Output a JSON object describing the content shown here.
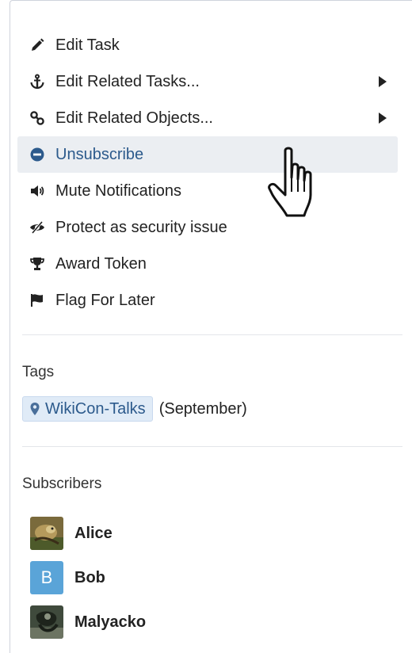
{
  "actions": [
    {
      "label": "Edit Task",
      "icon": "pencil-icon",
      "submenu": false
    },
    {
      "label": "Edit Related Tasks...",
      "icon": "anchor-icon",
      "submenu": true
    },
    {
      "label": "Edit Related Objects...",
      "icon": "link-icon",
      "submenu": true
    },
    {
      "label": "Unsubscribe",
      "icon": "minus-circle-icon",
      "submenu": false,
      "hovered": true
    },
    {
      "label": "Mute Notifications",
      "icon": "volume-icon",
      "submenu": false
    },
    {
      "label": "Protect as security issue",
      "icon": "eye-slash-icon",
      "submenu": false
    },
    {
      "label": "Award Token",
      "icon": "trophy-icon",
      "submenu": false
    },
    {
      "label": "Flag For Later",
      "icon": "flag-icon",
      "submenu": false
    }
  ],
  "tags": {
    "title": "Tags",
    "items": [
      {
        "label": "WikiCon-Talks",
        "suffix": "(September)",
        "icon": "map-pin-icon"
      }
    ]
  },
  "subscribers": {
    "title": "Subscribers",
    "items": [
      {
        "name": "Alice",
        "avatar": "photo"
      },
      {
        "name": "Bob",
        "avatar": "letter",
        "letter": "B"
      },
      {
        "name": "Malyacko",
        "avatar": "photo"
      }
    ]
  },
  "colors": {
    "hover_bg": "#ebeef2",
    "link": "#2c5a8c",
    "tag_bg": "#e0ebf7",
    "avatar_blue": "#5aa4d8"
  }
}
